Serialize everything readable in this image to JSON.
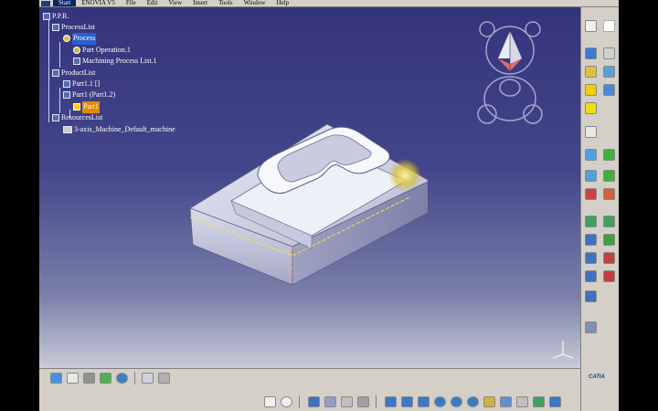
{
  "menu": {
    "items": [
      "Start",
      "ENOVIA V5",
      "File",
      "Edit",
      "View",
      "Insert",
      "Tools",
      "Window",
      "Help"
    ],
    "active_index": 0
  },
  "tree": {
    "root": "P.P.R.",
    "process_list": "ProcessList",
    "process": "Process",
    "part_operation": "Part Operation.1",
    "machining_process_list": "Machining Process List.1",
    "product_list": "ProductList",
    "part_1_1": "Part1.1 []",
    "part_1_part_1_2": "Part1 (Part1.2)",
    "part1": "Part1",
    "resources_list": "ResourcesList",
    "machine": "3-axis_Machine_Default_machine"
  },
  "brand": {
    "logo_text": "CATIA",
    "accent": "#1a3c8c"
  },
  "colors": {
    "viewport_top": "#34347c",
    "viewport_bottom": "#c9cbd6",
    "panel": "#d4d0c8",
    "selection_blue": "#2a5fd0",
    "selection_orange": "#e08a00"
  },
  "right_toolbar_icons": [
    "hidden-icon",
    "select-arrow-icon",
    "part-operation-icon",
    "machine-icon",
    "manufacturing-program-icon",
    "machining-process-icon",
    "tree-icon",
    "roughing-icon",
    "sweeping-icon",
    "zlevel-icon",
    "contour-icon",
    "pencil-icon",
    "spiral-icon",
    "drilling-icon",
    "pocketing-icon",
    "profile-icon",
    "facing-icon",
    "curve-following-icon",
    "point-to-point-icon",
    "tool-path-icon",
    "replay-icon",
    "simulation-icon",
    "nc-output-icon",
    "feature-icon",
    "report-icon",
    "axis-icon"
  ],
  "bottom_toolbar_icons_row1": [
    "part-icon",
    "table-icon",
    "tool-assembly-icon",
    "stock-icon",
    "rotate-icon",
    "transfer-icon",
    "plugin-icon"
  ],
  "bottom_toolbar_icons_row2": [
    "formula-icon",
    "comment-icon",
    "table-icon",
    "hierarchy-icon",
    "settings-icon",
    "probe-icon",
    "fly-icon",
    "fit-all-icon",
    "pan-icon",
    "rotate-view-icon",
    "zoom-in-icon",
    "zoom-out-icon",
    "normal-view-icon",
    "views-icon",
    "hide-show-icon",
    "swap-icon",
    "materials-icon"
  ]
}
